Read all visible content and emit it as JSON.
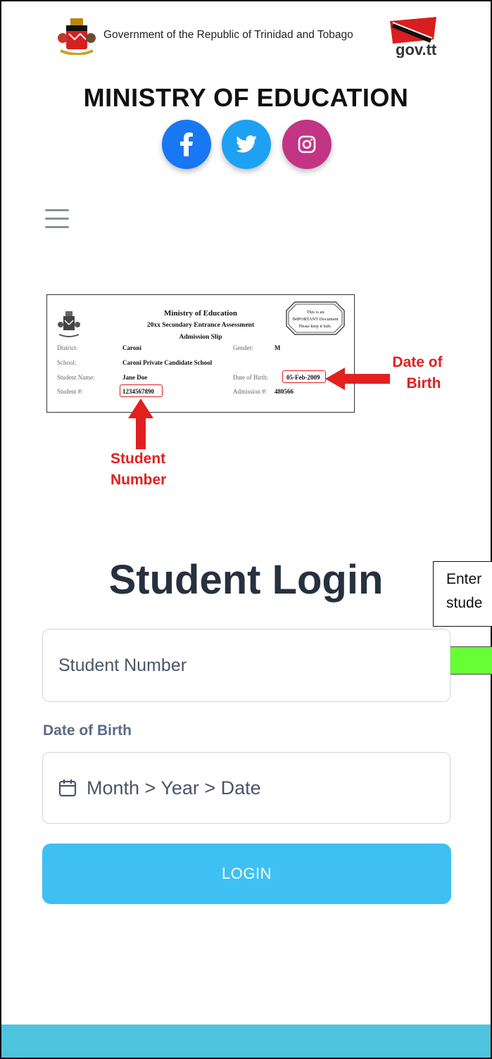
{
  "header": {
    "gov_text": "Government of the Republic of Trinidad and Tobago",
    "govtt_logo_text": "gov.tt"
  },
  "ministry_title": "MINISTRY OF EDUCATION",
  "social": {
    "facebook": "f"
  },
  "slip": {
    "title": "Ministry of Education",
    "subtitle": "20xx Secondary Entrance Assessment",
    "doc": "Admission Slip",
    "notice_line1": "This is an",
    "notice_line2": "IMPORTANT Document",
    "notice_line3": "Please keep it Safe.",
    "district_label": "District:",
    "district_value": "Caroni",
    "gender_label": "Gender:",
    "gender_value": "M",
    "school_label": "School:",
    "school_value": "Caroni Private Candidate School",
    "name_label": "Student Name:",
    "name_value": "Jane Doe",
    "dob_label": "Date of Birth:",
    "dob_value": "05-Feb-2009",
    "student_label": "Student #:",
    "student_value": "1234567890",
    "admission_label": "Admission #:",
    "admission_value": "480566"
  },
  "annotations": {
    "dob_line1": "Date of",
    "dob_line2": "Birth",
    "student_line1": "Student",
    "student_line2": "Number"
  },
  "tooltip": {
    "line1": "Enter",
    "line2": "stude"
  },
  "login": {
    "title": "Student Login",
    "student_placeholder": "Student Number",
    "dob_label": "Date of Birth",
    "dob_placeholder": "Month > Year > Date",
    "button": "LOGIN"
  },
  "colors": {
    "login_button": "#3fc0f3",
    "footer": "#4ec3de",
    "facebook": "#1877f2",
    "twitter": "#1da1f2",
    "instagram": "#c13584",
    "annotation": "#e22020"
  }
}
